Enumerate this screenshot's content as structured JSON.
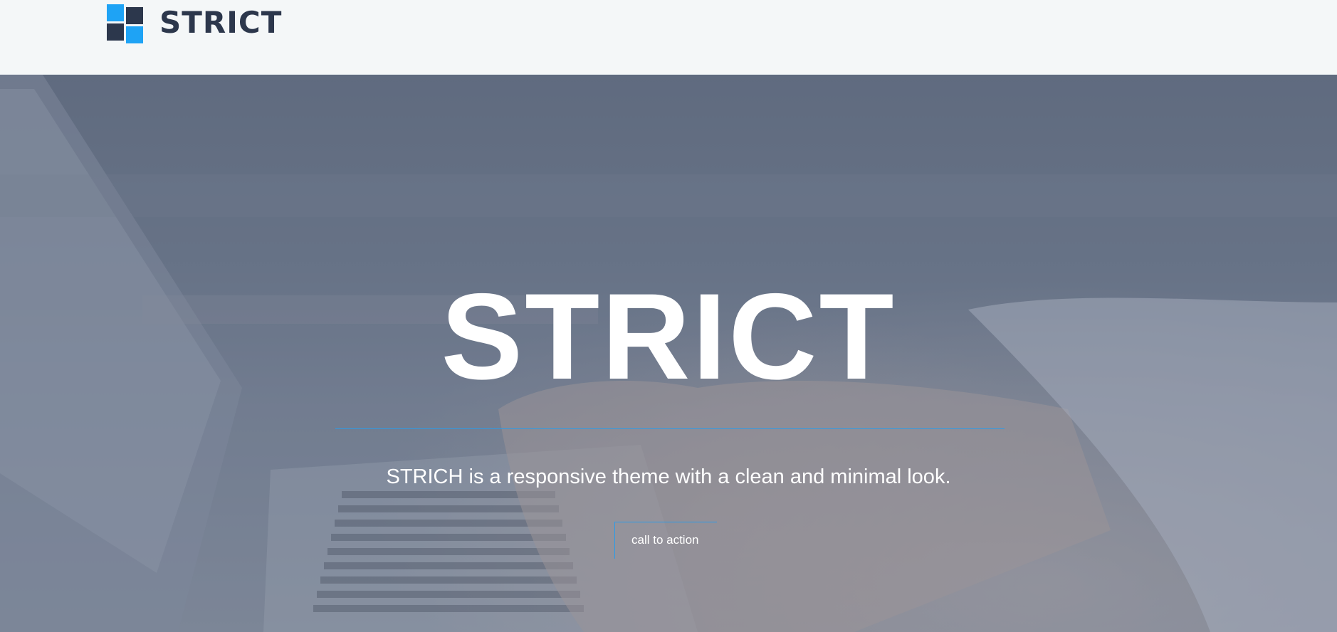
{
  "header": {
    "logo_text": "STRICT",
    "logo_icon": "four-squares-logo-icon",
    "logo_colors": [
      "#1ea3f5",
      "#2c374c"
    ]
  },
  "hero": {
    "background_image": "blurred-photo-hands-typing-on-laptop",
    "title": "STRICT",
    "subtitle": "STRICH is a responsive theme with a clean and minimal look.",
    "cta_label": "call to action",
    "accent_color": "#2c9be8"
  }
}
